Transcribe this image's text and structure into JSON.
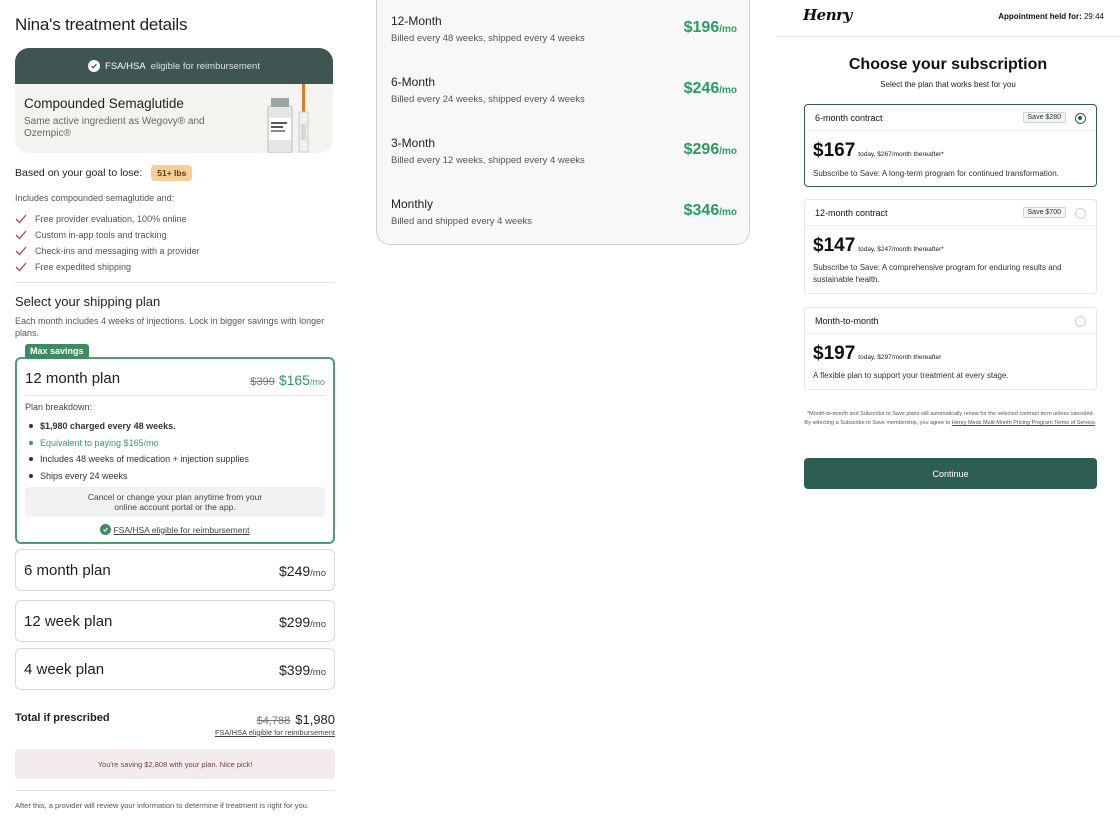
{
  "left": {
    "title": "Nina's treatment details",
    "med_card": {
      "fsa_bold": "FSA/HSA",
      "fsa_rest": "eligible for reimbursement",
      "name": "Compounded Semaglutide",
      "subtitle": "Same active ingredient as Wegovy® and Ozempic®"
    },
    "goal": {
      "label": "Based on your goal to lose:",
      "pill": "51+ lbs"
    },
    "includes_heading": "Includes compounded semaglutide and:",
    "features": [
      "Free provider evaluation, 100% online",
      "Custom in-app tools and tracking",
      "Check-ins and messaging with a provider",
      "Free expedited shipping"
    ],
    "shipping": {
      "title": "Select your shipping plan",
      "subtitle": "Each month includes 4 weeks of injections. Lock in bigger savings with longer plans.",
      "badge": "Max savings",
      "selected_plan": {
        "name": "12 month plan",
        "old_price": "$399",
        "price": "$165",
        "per": "/mo",
        "breakdown_heading": "Plan breakdown:",
        "breakdown": [
          "$1,980 charged every 48 weeks.",
          "Equivalent to paying $165/mo",
          "Includes 48 weeks of medication + injection supplies",
          "Ships every 24 weeks"
        ],
        "cancel_line1": "Cancel or change your plan anytime from your",
        "cancel_line2": "online account portal or the app.",
        "fsa": "FSA/HSA eligible for reimbursement"
      },
      "other_plans": [
        {
          "name": "6 month plan",
          "price": "$249",
          "per": "/mo"
        },
        {
          "name": "12 week plan",
          "price": "$299",
          "per": "/mo"
        },
        {
          "name": "4 week plan",
          "price": "$399",
          "per": "/mo"
        }
      ]
    },
    "total": {
      "label": "Total if prescribed",
      "old": "$4,788",
      "amount": "$1,980",
      "fsa": "FSA/HSA eligible for reimbursement"
    },
    "saving_message": "You're saving $2,808 with your plan. Nice pick!",
    "after_note": "After this, a provider will review your information to determine if treatment is right for you."
  },
  "middle": {
    "rows": [
      {
        "name": "12-Month",
        "sub": "Billed every 48 weeks, shipped every 4 weeks",
        "price": "$196",
        "per": "/mo"
      },
      {
        "name": "6-Month",
        "sub": "Billed every 24 weeks, shipped every 4 weeks",
        "price": "$246",
        "per": "/mo"
      },
      {
        "name": "3-Month",
        "sub": "Billed every 12 weeks, shipped every 4 weeks",
        "price": "$296",
        "per": "/mo"
      },
      {
        "name": "Monthly",
        "sub": "Billed and shipped every 4 weeks",
        "price": "$346",
        "per": "/mo"
      }
    ]
  },
  "right": {
    "logo": "Henry",
    "appt_label": "Appointment held for:",
    "appt_time": "29:44",
    "title": "Choose your subscription",
    "subtitle": "Select the plan that works best for you",
    "cards": [
      {
        "title": "6-month contract",
        "badge": "Save $280",
        "price": "$167",
        "detail": "today, $267/month thereafter*",
        "desc": "Subscribe to Save: A long-term program for continued transformation.",
        "selected": true
      },
      {
        "title": "12-month contract",
        "badge": "Save $700",
        "price": "$147",
        "detail": "today, $247/month thereafter*",
        "desc": "Subscribe to Save: A comprehensive program for enduring results and sustainable health.",
        "selected": false
      },
      {
        "title": "Month-to-month",
        "badge": "",
        "price": "$197",
        "detail": "today, $297/month thereafter",
        "desc": "A flexible plan to support your treatment at every stage.",
        "selected": false
      }
    ],
    "fine_print": "*Month-to-month and Subscribe to Save plans will automatically renew for the selected contract term unless canceled. By selecting a Subscribe to Save membership, you agree to ",
    "fine_link": "Henry Meds Multi-Month Pricing Program Terms of Service",
    "fine_end": ".",
    "continue_label": "Continue"
  },
  "colors": {
    "brand_dark": "#2e5e53",
    "accent_green": "#2b9b64",
    "banner": "#3e5551",
    "pill": "#f6cf97"
  }
}
